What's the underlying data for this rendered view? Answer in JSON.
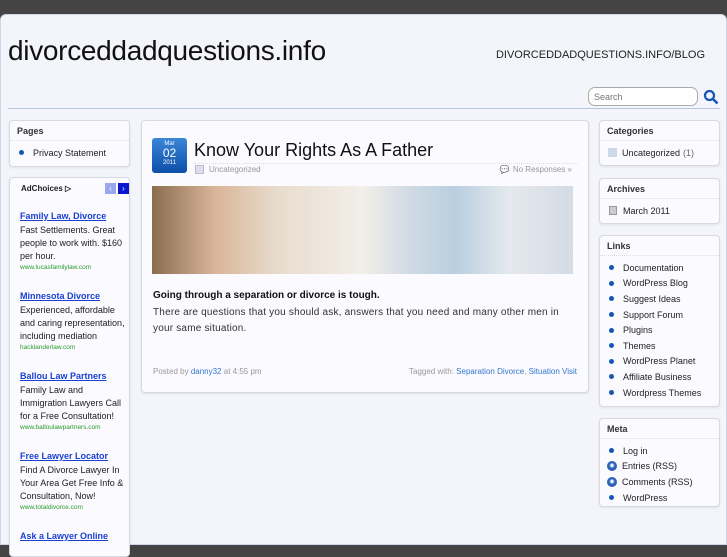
{
  "header": {
    "site_title": "divorceddadquestions.info",
    "site_url": "DIVORCEDDADQUESTIONS.INFO/BLOG",
    "search_placeholder": "Search"
  },
  "left_sidebar": {
    "pages_title": "Pages",
    "pages": [
      "Privacy Statement"
    ],
    "adchoices": "AdChoices",
    "ads": [
      {
        "title": "Family Law, Divorce",
        "text": "Fast Settlements. Great people to work with. $160 per hour.",
        "url": "www.lucasfamilylaw.com"
      },
      {
        "title": "Minnesota Divorce",
        "text": "Experienced, affordable and caring representation, including mediation",
        "url": "hacklanderlaw.com"
      },
      {
        "title": "Ballou Law Partners",
        "text": "Family Law and Immigration Lawyers Call for a Free Consultation!",
        "url": "www.balloulawpartners.com"
      },
      {
        "title": "Free Lawyer Locator",
        "text": "Find A Divorce Lawyer In Your Area Get Free Info & Consultation, Now!",
        "url": "www.totaldivorce.com"
      },
      {
        "title": "Ask a Lawyer Online",
        "text": "",
        "url": ""
      }
    ]
  },
  "post": {
    "month": "Mar",
    "day": "02",
    "year": "2011",
    "title": "Know Your Rights As A Father",
    "category": "Uncategorized",
    "responses": "No Responses »",
    "lead": "Going through a separation or divorce is tough.",
    "body": "There are questions that you should ask, answers that you need and many other men in your same situation.",
    "posted_by": "Posted by",
    "author": "danny32",
    "time": "at 4:55 pm",
    "tagged_with": "Tagged with:",
    "tags": [
      "Separation Divorce",
      "Situation Visit"
    ],
    "tag_sep": ","
  },
  "right_sidebar": {
    "categories_title": "Categories",
    "categories": [
      {
        "name": "Uncategorized",
        "count": "(1)"
      }
    ],
    "archives_title": "Archives",
    "archives": [
      "March 2011"
    ],
    "links_title": "Links",
    "links": [
      "Documentation",
      "WordPress Blog",
      "Suggest Ideas",
      "Support Forum",
      "Plugins",
      "Themes",
      "WordPress Planet",
      "Affiliate Business",
      "Wordpress Themes"
    ],
    "meta_title": "Meta",
    "meta": [
      "Log in",
      "Entries (RSS)",
      "Comments (RSS)",
      "WordPress"
    ]
  },
  "colors": {
    "accent": "#1556b5",
    "link": "#3476cc",
    "ad_link": "#1a3fd1",
    "ad_url": "#2a9a2a"
  }
}
